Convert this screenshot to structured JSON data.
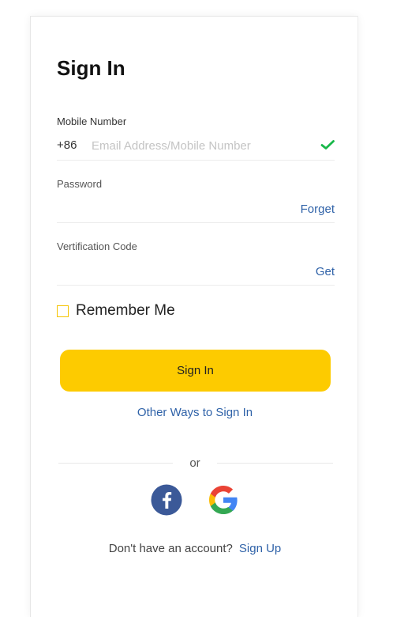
{
  "title": "Sign In",
  "mobile": {
    "label": "Mobile Number",
    "prefix": "+86",
    "placeholder": "Email Address/Mobile Number",
    "value": "",
    "status_icon": "check-icon",
    "status_color": "#19b84a"
  },
  "password": {
    "label": "Password",
    "value": "",
    "forget_label": "Forget"
  },
  "verification": {
    "label": "Vertification Code",
    "value": "",
    "get_label": "Get"
  },
  "remember": {
    "label": "Remember Me",
    "checked": false
  },
  "signin_button": "Sign In",
  "other_ways": "Other Ways to Sign In",
  "divider": "or",
  "social": [
    {
      "name": "facebook-icon",
      "color": "#3b5998"
    },
    {
      "name": "google-icon",
      "colors": [
        "#ea4335",
        "#fbbc05",
        "#34a853",
        "#4285f4"
      ]
    }
  ],
  "signup": {
    "prompt": "Don't have an account?",
    "link": "Sign Up"
  },
  "colors": {
    "accent": "#fdcb00",
    "link": "#2f62a8"
  }
}
